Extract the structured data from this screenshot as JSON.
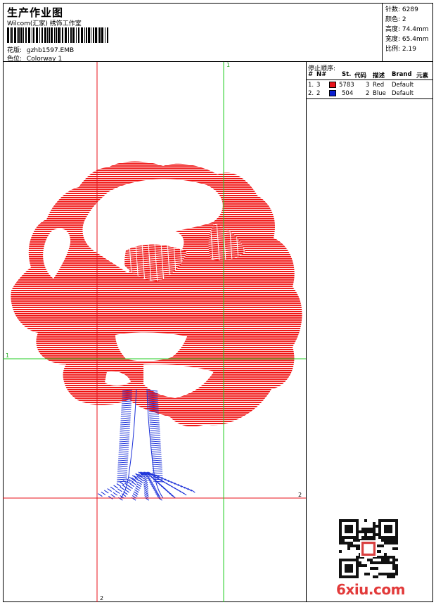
{
  "header": {
    "title": "生产作业图",
    "subtitle": "Wilcom(汇家) 绣饰工作室",
    "pattern_label": "花版:",
    "pattern_value": "gzhb1597.EMB",
    "color_label": "色位:",
    "color_value": "Colorway 1"
  },
  "specs": [
    {
      "label": "针数:",
      "value": "6289"
    },
    {
      "label": "颜色:",
      "value": "2"
    },
    {
      "label": "高度:",
      "value": "74.4mm"
    },
    {
      "label": "宽度:",
      "value": "65.4mm"
    },
    {
      "label": "比例:",
      "value": "2.19"
    }
  ],
  "stop_sequence": {
    "title": "停止顺序:",
    "columns": [
      "#",
      "N#",
      "St.",
      "代码",
      "描述",
      "Brand",
      "元素"
    ],
    "rows": [
      {
        "idx": "1.",
        "needle": "3",
        "color": "#e8121a",
        "stitches": "5783",
        "code": "3",
        "desc": "Red",
        "brand": "Default"
      },
      {
        "idx": "2.",
        "needle": "2",
        "color": "#0a1fd1",
        "stitches": "504",
        "code": "2",
        "desc": "Blue",
        "brand": "Default"
      }
    ]
  },
  "guides": {
    "marker_1": "1",
    "marker_2": "2"
  },
  "colors": {
    "red_guide": "#e8121a",
    "green_guide": "#22cc22",
    "tree_red": "#f01010",
    "trunk_blue": "#1a2fd8"
  },
  "watermark": "6xiu.com"
}
